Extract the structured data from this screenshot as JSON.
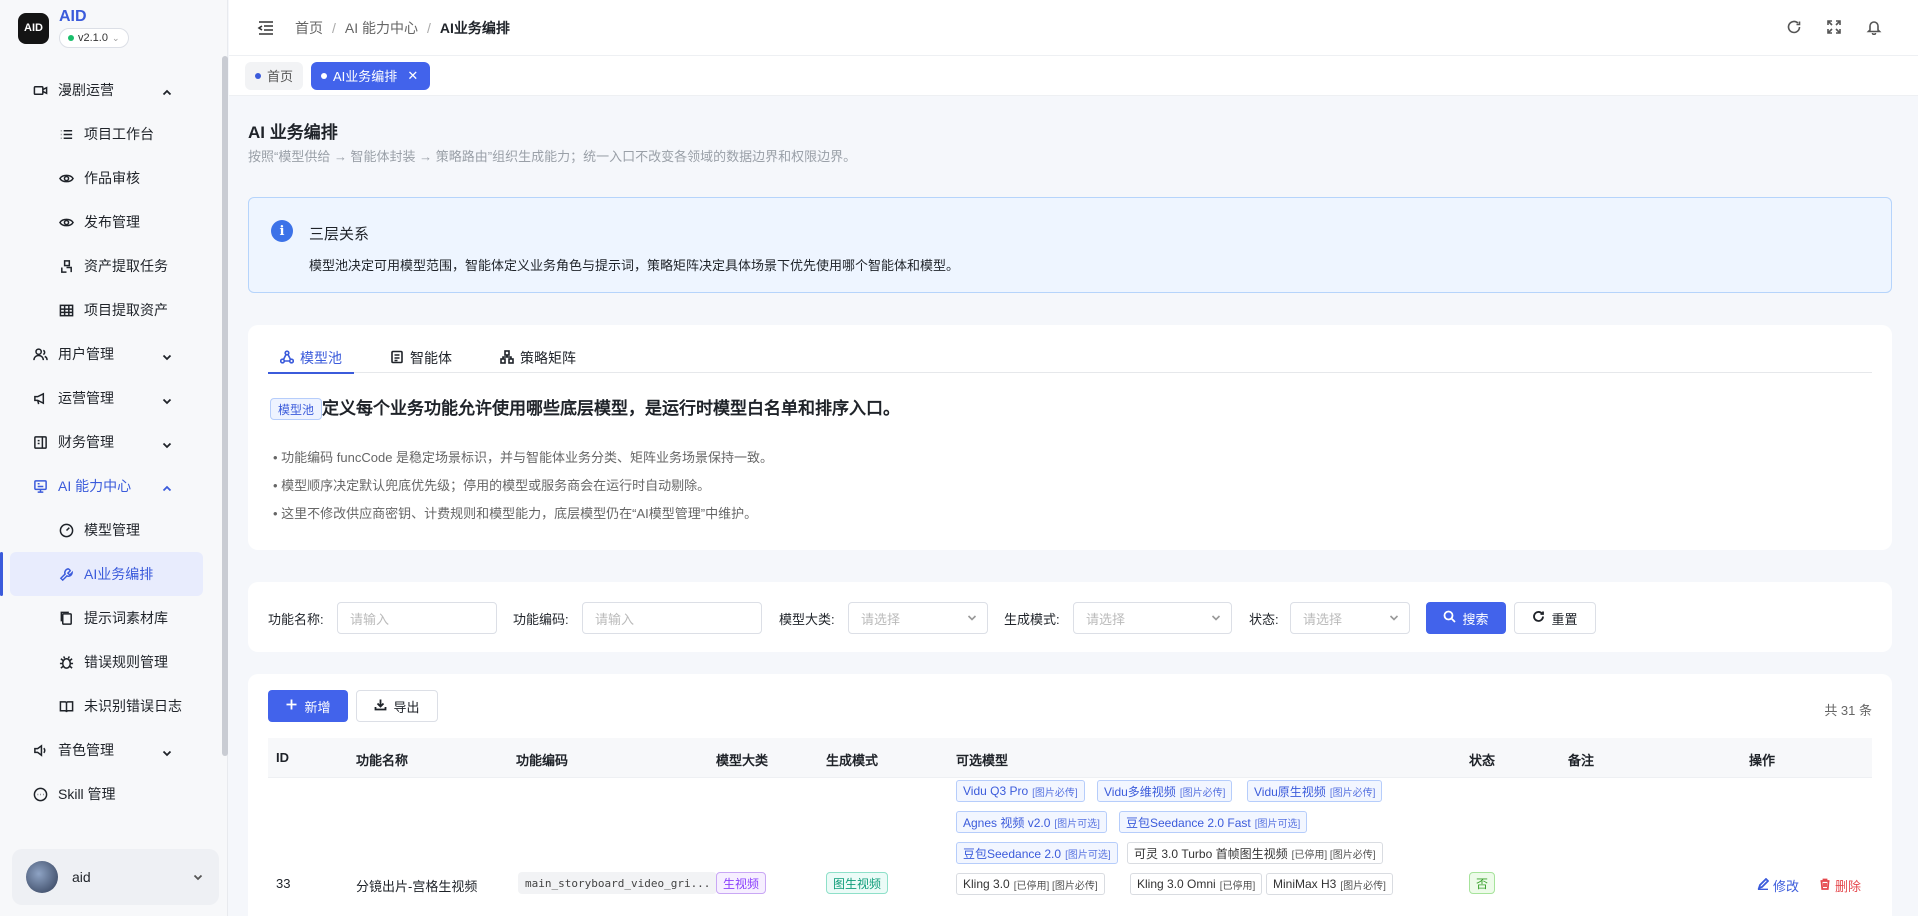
{
  "brand": {
    "logo_text": "AID",
    "name": "AID",
    "version": "v2.1.0"
  },
  "sidebar": {
    "items": [
      {
        "label": "漫剧运营",
        "icon": "video-icon",
        "type": "group",
        "state": "open"
      },
      {
        "label": "项目工作台",
        "icon": "list-icon",
        "type": "sub"
      },
      {
        "label": "作品审核",
        "icon": "eye-icon",
        "type": "sub"
      },
      {
        "label": "发布管理",
        "icon": "eye-icon",
        "type": "sub"
      },
      {
        "label": "资产提取任务",
        "icon": "extract-icon",
        "type": "sub"
      },
      {
        "label": "项目提取资产",
        "icon": "table-icon",
        "type": "sub"
      },
      {
        "label": "用户管理",
        "icon": "users-icon",
        "type": "group",
        "state": "closed"
      },
      {
        "label": "运营管理",
        "icon": "megaphone-icon",
        "type": "group",
        "state": "closed"
      },
      {
        "label": "财务管理",
        "icon": "ledger-icon",
        "type": "group",
        "state": "closed"
      },
      {
        "label": "AI 能力中心",
        "icon": "ai-icon",
        "type": "group",
        "state": "open"
      },
      {
        "label": "模型管理",
        "icon": "gauge-icon",
        "type": "sub"
      },
      {
        "label": "AI业务编排",
        "icon": "wrench-icon",
        "type": "sub",
        "active": true
      },
      {
        "label": "提示词素材库",
        "icon": "files-icon",
        "type": "sub"
      },
      {
        "label": "错误规则管理",
        "icon": "bug-icon",
        "type": "sub"
      },
      {
        "label": "未识别错误日志",
        "icon": "book-icon",
        "type": "sub"
      },
      {
        "label": "音色管理",
        "icon": "speaker-icon",
        "type": "group",
        "state": "closed"
      },
      {
        "label": "Skill 管理",
        "icon": "chat-icon",
        "type": "group-flat"
      }
    ]
  },
  "user": {
    "name": "aid"
  },
  "header": {
    "breadcrumb": [
      "首页",
      "AI 能力中心",
      "AI业务编排"
    ]
  },
  "tags": [
    {
      "label": "首页",
      "active": false
    },
    {
      "label": "AI业务编排",
      "active": true
    }
  ],
  "page": {
    "title": "AI 业务编排",
    "subtitle": "按照“模型供给 → 智能体封装 → 策略路由”组织生成能力；统一入口不改变各领域的数据边界和权限边界。"
  },
  "info": {
    "title": "三层关系",
    "text": "模型池决定可用模型范围，智能体定义业务角色与提示词，策略矩阵决定具体场景下优先使用哪个智能体和模型。"
  },
  "tabs": [
    {
      "label": "模型池",
      "icon": "model-pool-icon",
      "active": true
    },
    {
      "label": "智能体",
      "icon": "agent-icon",
      "active": false
    },
    {
      "label": "策略矩阵",
      "icon": "matrix-icon",
      "active": false
    }
  ],
  "pool": {
    "badge": "模型池",
    "heading": "定义每个业务功能允许使用哪些底层模型，是运行时模型白名单和排序入口。",
    "bullets": [
      "• 功能编码 funcCode 是稳定场景标识，并与智能体业务分类、矩阵业务场景保持一致。",
      "• 模型顺序决定默认兜底优先级；停用的模型或服务商会在运行时自动剔除。",
      "• 这里不修改供应商密钥、计费规则和模型能力，底层模型仍在“AI模型管理”中维护。"
    ]
  },
  "filters": {
    "name_label": "功能名称:",
    "name_placeholder": "请输入",
    "code_label": "功能编码:",
    "code_placeholder": "请输入",
    "category_label": "模型大类:",
    "category_placeholder": "请选择",
    "mode_label": "生成模式:",
    "mode_placeholder": "请选择",
    "status_label": "状态:",
    "status_placeholder": "请选择",
    "search_label": "搜索",
    "reset_label": "重置"
  },
  "toolbar": {
    "add_label": "新增",
    "export_label": "导出",
    "total": "共 31 条"
  },
  "table": {
    "columns": [
      "ID",
      "功能名称",
      "功能编码",
      "模型大类",
      "生成模式",
      "可选模型",
      "状态",
      "备注",
      "操作"
    ],
    "rows": [
      {
        "id": "33",
        "name": "分镜出片-宫格生视频",
        "code": "main_storyboard_video_gri...",
        "category": "生视频",
        "mode": "图生视频",
        "status": "否",
        "remark": "",
        "edit_label": "修改",
        "delete_label": "删除",
        "models": [
          {
            "name": "Vidu Q3 Pro",
            "note": "[图片必传]",
            "style": "blue"
          },
          {
            "name": "Vidu多维视频",
            "note": "[图片必传]",
            "style": "blue"
          },
          {
            "name": "Vidu原生视频",
            "note": "[图片必传]",
            "style": "blue"
          },
          {
            "name": "Agnes 视频 v2.0",
            "note": "[图片可选]",
            "style": "blue"
          },
          {
            "name": "豆包Seedance 2.0 Fast",
            "note": "[图片可选]",
            "style": "blue"
          },
          {
            "name": "豆包Seedance 2.0",
            "note": "[图片可选]",
            "style": "blue"
          },
          {
            "name": "可灵 3.0 Turbo 首帧图生视频",
            "note": "[已停用] [图片必传]",
            "style": "gray"
          },
          {
            "name": "Kling 3.0",
            "note": "[已停用] [图片必传]",
            "style": "gray"
          },
          {
            "name": "Kling 3.0 Omni",
            "note": "[已停用]",
            "style": "gray"
          },
          {
            "name": "MiniMax H3",
            "note": "[图片必传]",
            "style": "gray"
          }
        ]
      }
    ]
  },
  "colors": {
    "accent": "#4263eb",
    "danger": "#e5484d",
    "info_bg": "#eef5ff"
  }
}
